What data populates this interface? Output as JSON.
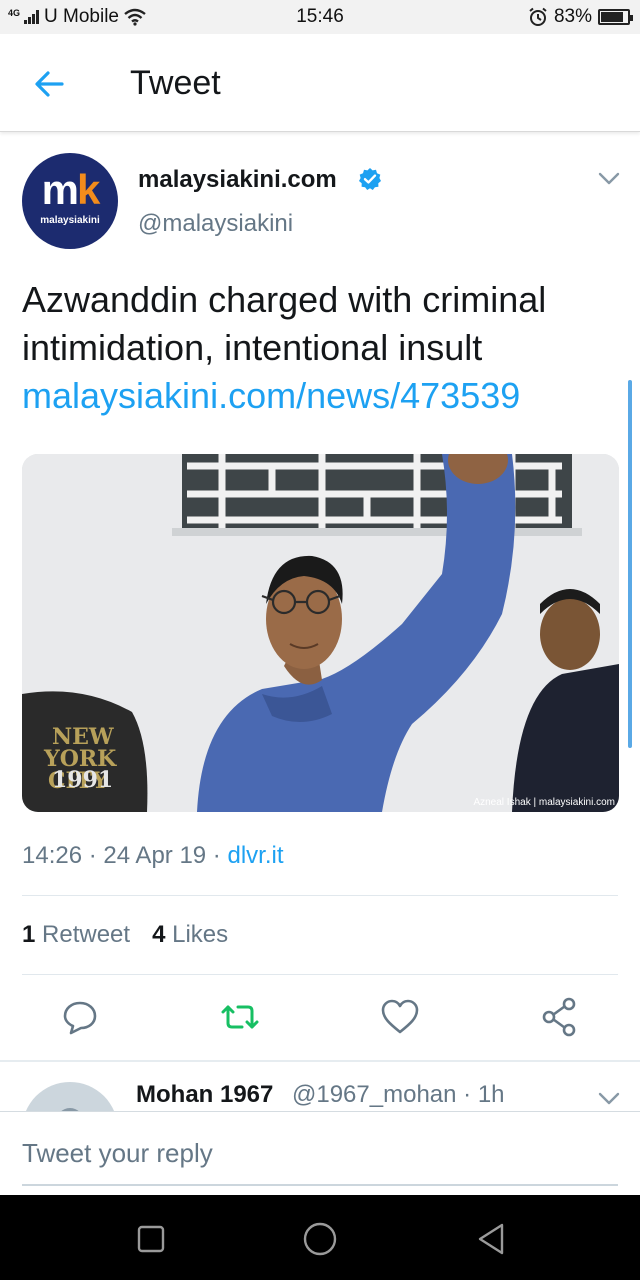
{
  "status_bar": {
    "network": "4G",
    "carrier": "U Mobile",
    "time": "15:46",
    "battery": "83%",
    "battery_level": 0.83
  },
  "app_bar": {
    "title": "Tweet",
    "back_icon": "arrow-left-icon"
  },
  "tweet": {
    "author": {
      "name": "malaysiakini.com",
      "handle": "@malaysiakini",
      "verified": true,
      "avatar_mark_m": "m",
      "avatar_mark_k": "k",
      "avatar_word": "malaysiakini"
    },
    "text": "Azwanddin charged with criminal intimidation, intentional insult",
    "link": "malaysiakini.com/news/473539",
    "photo": {
      "credit": "Azneal Ishak | malaysiakini.com",
      "shirt_text_1": "NEW",
      "shirt_text_2": "YORK",
      "shirt_text_3": "CITY",
      "shirt_text_4": "1991"
    },
    "time": "14:26",
    "date": "24 Apr 19",
    "source": "dlvr.it",
    "retweets_count": "1",
    "retweets_label": "Retweet",
    "likes_count": "4",
    "likes_label": "Likes",
    "actions": [
      "reply-icon",
      "retweet-icon",
      "like-icon",
      "share-icon"
    ]
  },
  "reply_preview": {
    "name": "Mohan 1967",
    "handle": "@1967_mohan",
    "age": "1h"
  },
  "composer": {
    "placeholder": "Tweet your reply"
  },
  "colors": {
    "accent": "#1da1f2",
    "retweet": "#17bf63",
    "secondary_text": "#657786"
  }
}
